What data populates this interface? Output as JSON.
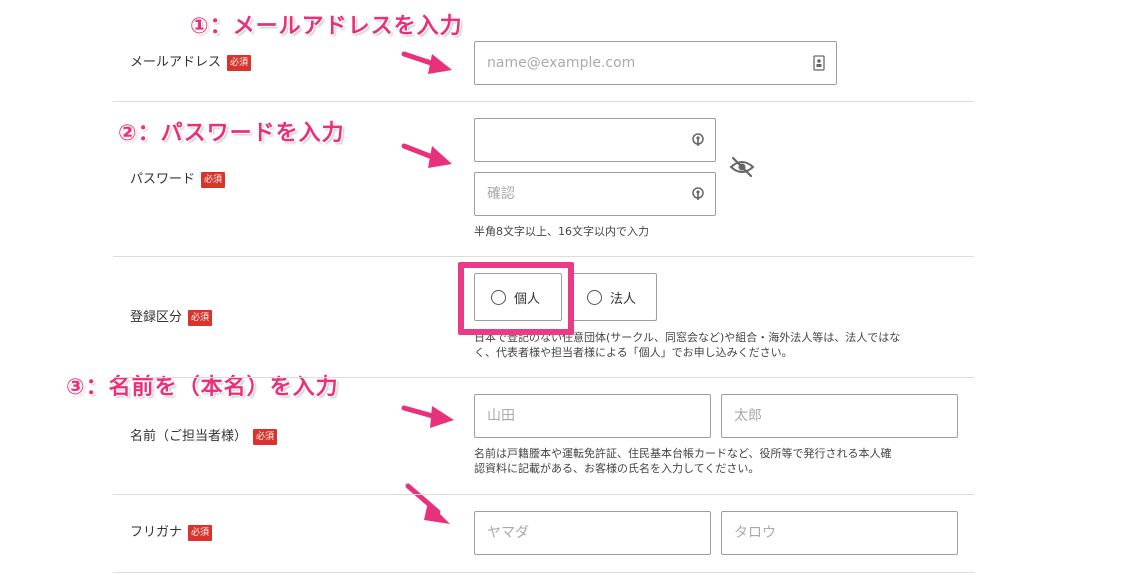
{
  "annotations": {
    "step1": "①：メールアドレスを入力",
    "step2": "②：パスワードを入力",
    "step3": "③：名前を（本名）を入力"
  },
  "required_badge": "必須",
  "email": {
    "label": "メールアドレス",
    "placeholder": "name@example.com"
  },
  "password": {
    "label": "パスワード",
    "placeholder": "",
    "confirm_placeholder": "確認",
    "note": "半角8文字以上、16文字以内で入力"
  },
  "registration_type": {
    "label": "登録区分",
    "options": [
      "個人",
      "法人"
    ],
    "note_line1": "日本で登記のない任意団体(サークル、同窓会など)や組合・海外法人等は、法人ではな",
    "note_line2": "く、代表者様や担当者様による「個人」でお申し込みください。"
  },
  "name": {
    "label": "名前（ご担当者様）",
    "last_placeholder": "山田",
    "first_placeholder": "太郎",
    "note_line1": "名前は戸籍謄本や運転免許証、住民基本台帳カードなど、役所等で発行される本人確",
    "note_line2": "認資料に記載がある、お客様の氏名を入力してください。"
  },
  "furigana": {
    "label": "フリガナ",
    "last_placeholder": "ヤマダ",
    "first_placeholder": "タロウ"
  },
  "icons": {
    "email_field": "contact-card-icon",
    "password_field": "key-icon",
    "toggle": "eye-slash-icon",
    "arrows": "arrow-right-icon"
  },
  "colors": {
    "annotation": "#e8317a",
    "required": "#d9342b",
    "border": "#9e9e9e"
  }
}
